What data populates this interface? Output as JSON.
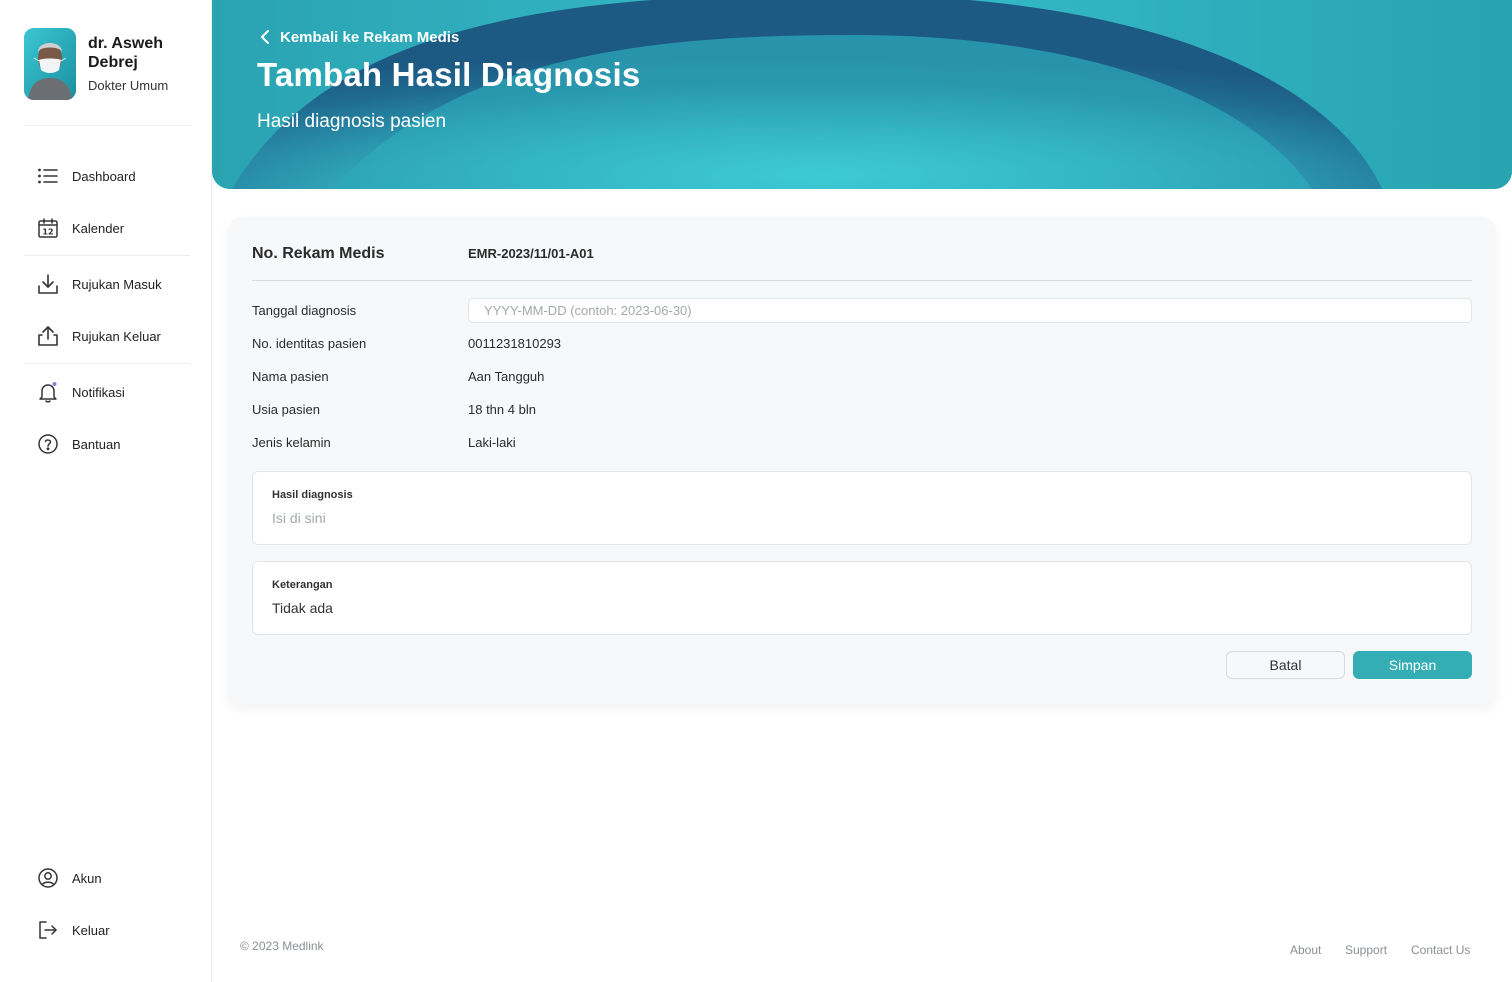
{
  "profile": {
    "name": "dr. Asweh Debrej",
    "role": "Dokter Umum"
  },
  "sidebar": {
    "items": [
      {
        "label": "Dashboard",
        "icon": "list-icon"
      },
      {
        "label": "Kalender",
        "icon": "calendar-icon",
        "icon_text": "12"
      },
      {
        "label": "Rujukan Masuk",
        "icon": "download-icon"
      },
      {
        "label": "Rujukan Keluar",
        "icon": "upload-icon"
      },
      {
        "label": "Notifikasi",
        "icon": "bell-icon"
      },
      {
        "label": "Bantuan",
        "icon": "help-circle-icon"
      }
    ],
    "bottom_items": [
      {
        "label": "Akun",
        "icon": "user-circle-icon"
      },
      {
        "label": "Keluar",
        "icon": "logout-icon"
      }
    ]
  },
  "header": {
    "back_label": "Kembali ke Rekam Medis",
    "title": "Tambah Hasil Diagnosis",
    "subtitle": "Hasil diagnosis pasien"
  },
  "form": {
    "record_label": "No. Rekam Medis",
    "record_value": "EMR-2023/11/01-A01",
    "date_label": "Tanggal diagnosis",
    "date_placeholder": "YYYY-MM-DD (contoh: 2023-06-30)",
    "patient_id_label": "No. identitas pasien",
    "patient_id_value": "0011231810293",
    "patient_name_label": "Nama pasien",
    "patient_name_value": "Aan Tangguh",
    "patient_age_label": "Usia pasien",
    "patient_age_value": "18 thn 4 bln",
    "gender_label": "Jenis kelamin",
    "gender_value": "Laki-laki",
    "diagnosis_label": "Hasil diagnosis",
    "diagnosis_placeholder": "Isi di sini",
    "notes_label": "Keterangan",
    "notes_value": "Tidak ada",
    "cancel_label": "Batal",
    "save_label": "Simpan"
  },
  "footer": {
    "copyright": "© 2023 Medlink",
    "links": [
      "About",
      "Support",
      "Contact Us"
    ]
  },
  "colors": {
    "accent": "#35adb4",
    "banner_light": "#3ccfd8",
    "banner_dark": "#1e5f86"
  }
}
